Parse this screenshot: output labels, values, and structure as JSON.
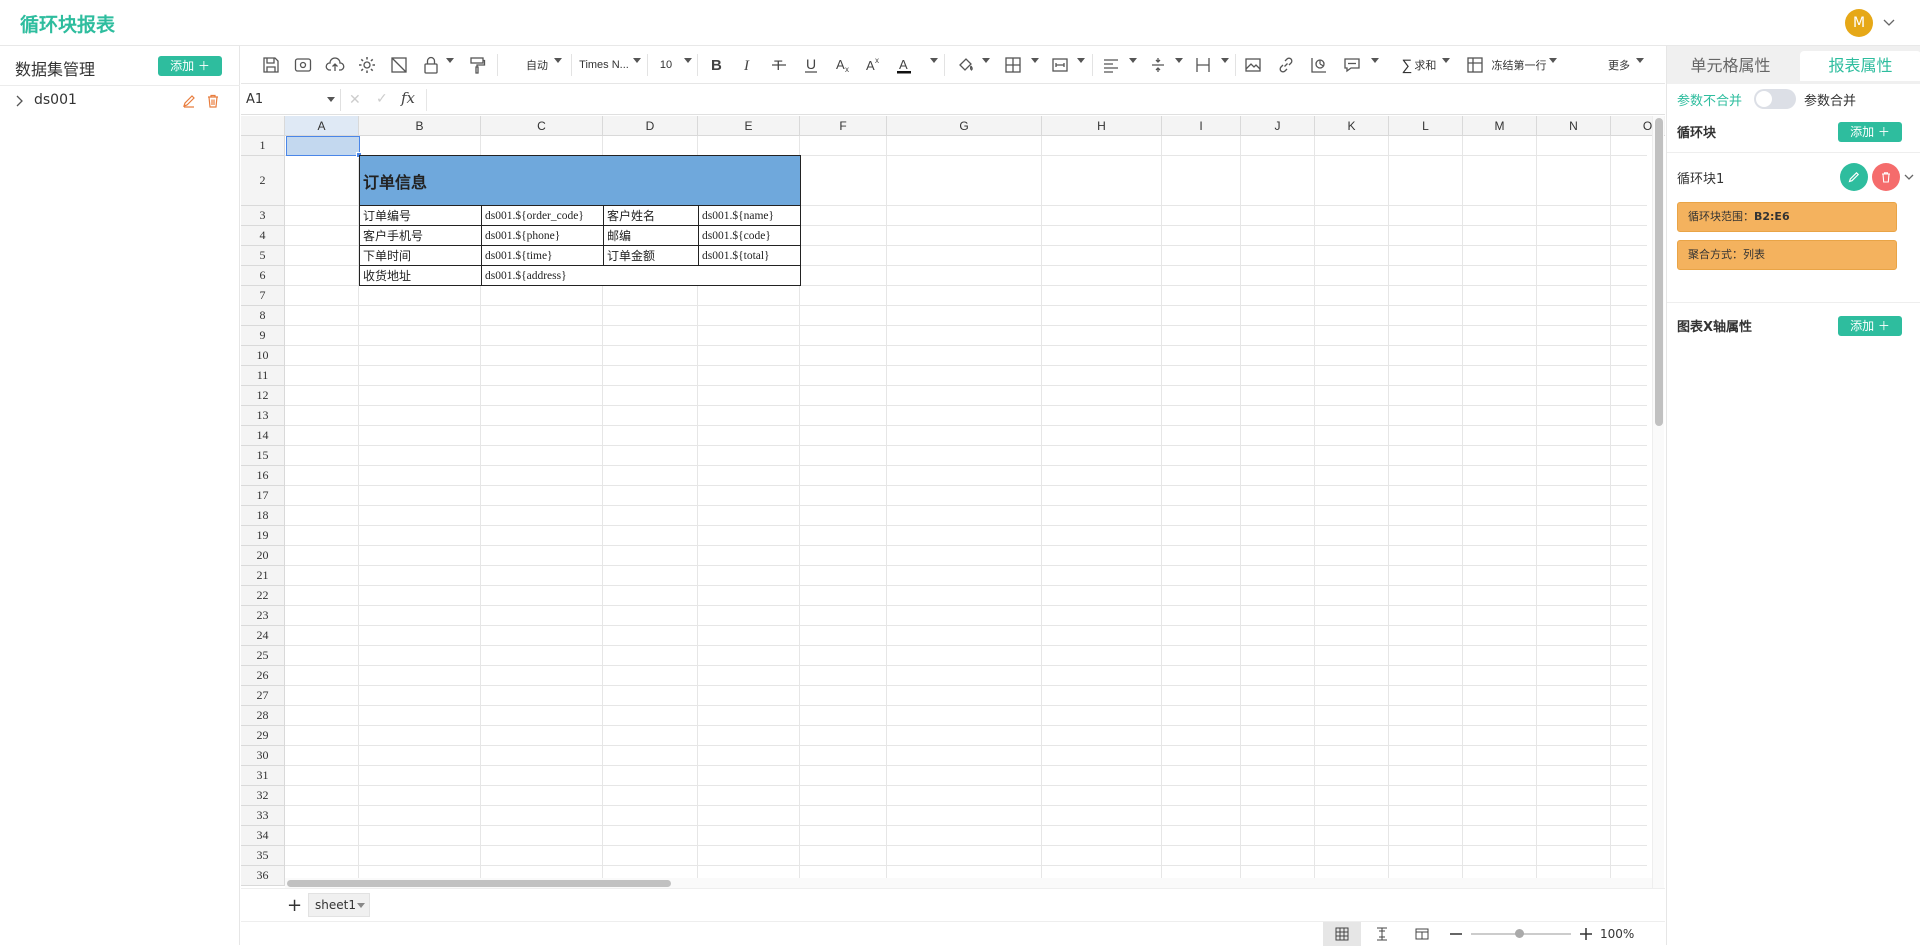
{
  "app": {
    "title": "循环块报表",
    "user_initial": "M"
  },
  "left_panel": {
    "title": "数据集管理",
    "add_label": "添加 ＋",
    "datasets": [
      {
        "name": "ds001"
      }
    ]
  },
  "toolbar": {
    "auto_label": "自动",
    "font_name": "Times N...",
    "font_size": "10",
    "sum_label": "求和",
    "freeze_label": "冻结第一行",
    "more_label": "更多"
  },
  "formula_bar": {
    "cell_ref": "A1",
    "fx": "fx",
    "cancel": "✕",
    "confirm": "✓",
    "value": ""
  },
  "sheet": {
    "columns": [
      "A",
      "B",
      "C",
      "D",
      "E",
      "F",
      "G",
      "H",
      "I",
      "J",
      "K",
      "L",
      "M",
      "N",
      "O"
    ],
    "rows": [
      "1",
      "2",
      "3",
      "4",
      "5",
      "6",
      "7",
      "8",
      "9",
      "10",
      "11",
      "12",
      "13",
      "14",
      "15",
      "16",
      "17",
      "18",
      "19",
      "20",
      "21",
      "22",
      "23",
      "24",
      "25",
      "26",
      "27",
      "28",
      "29",
      "30",
      "31",
      "32",
      "33",
      "34",
      "35",
      "36"
    ],
    "title_cell": "订单信息",
    "labels": {
      "order_code": "订单编号",
      "customer_name": "客户姓名",
      "phone": "客户手机号",
      "postcode": "邮编",
      "order_time": "下单时间",
      "order_amount": "订单金额",
      "address": "收货地址"
    },
    "fields": {
      "order_code": "ds001.${order_code}",
      "name": "ds001.${name}",
      "phone": "ds001.${phone}",
      "code": "ds001.${code}",
      "time": "ds001.${time}",
      "total": "ds001.${total}",
      "address": "ds001.${address}"
    }
  },
  "sheet_tabs": {
    "add": "+",
    "tabs": [
      "sheet1"
    ]
  },
  "status": {
    "zoom": "100%"
  },
  "right_panel": {
    "tab_cell": "单元格属性",
    "tab_report": "报表属性",
    "param_not_merge": "参数不合并",
    "param_merge": "参数合并",
    "loop_block_label": "循环块",
    "add_label": "添加 ＋",
    "loop_item": "循环块1",
    "range_prefix": "循环块范围：",
    "range_value": "B2:E6",
    "agg_prefix": "聚合方式：",
    "agg_value": "列表",
    "chart_x_label": "图表X轴属性"
  },
  "colors": {
    "accent": "#2ebd9e",
    "title_fill": "#6fa8dc",
    "tag_fill": "#f4b25e",
    "delete": "#f56c6c",
    "avatar": "#e6a817"
  }
}
